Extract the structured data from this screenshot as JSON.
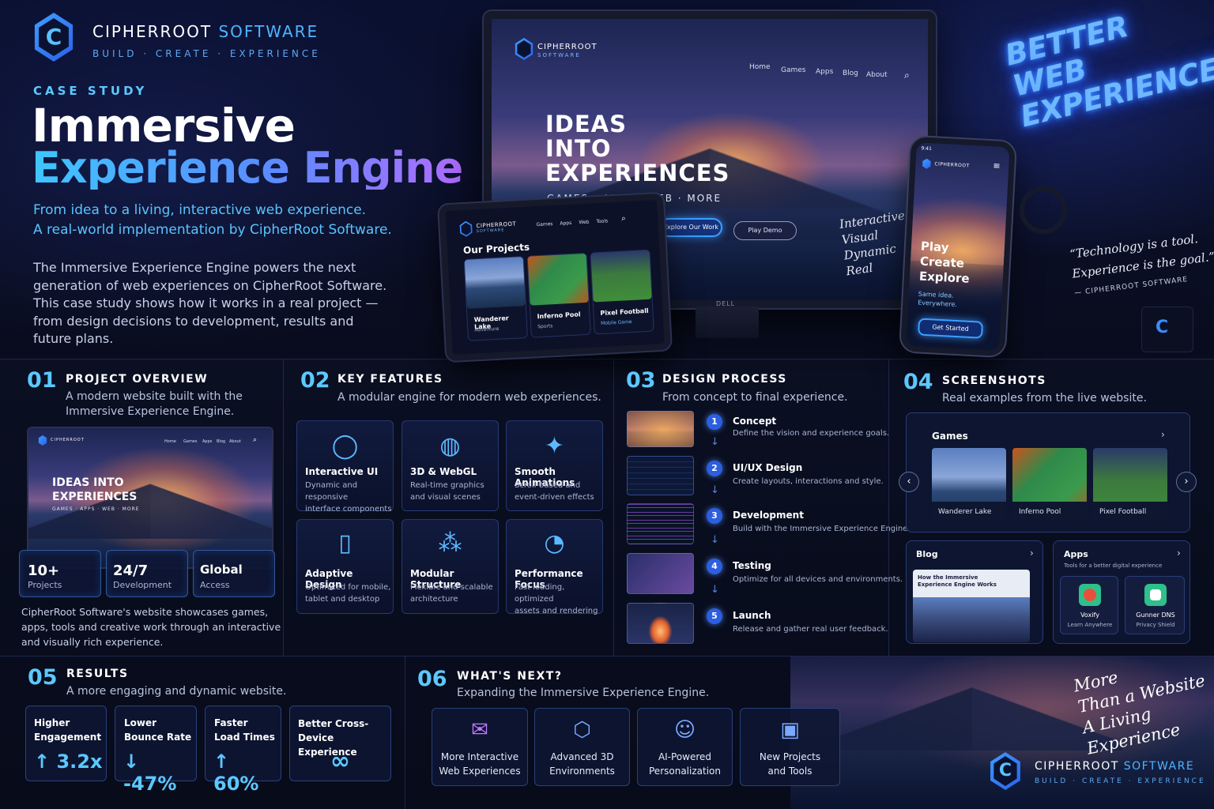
{
  "brand": {
    "name_a": "CIPHERROOT",
    "name_b": "SOFTWARE",
    "tagline": "BUILD · CREATE · EXPERIENCE",
    "logo_letter": "C"
  },
  "hero": {
    "kicker": "CASE STUDY",
    "title_line1": "Immersive",
    "title_line2": "Experience Engine",
    "lead_1": "From idea to a living, interactive web experience.",
    "lead_2": "A real-world implementation by CipherRoot Software.",
    "body": [
      "The Immersive Experience Engine powers the next",
      "generation of web experiences on CipherRoot Software.",
      "This case study shows how it works in a real project —",
      "from design decisions to development, results and",
      "future plans."
    ]
  },
  "monitor": {
    "logo_name": "CIPHERROOT",
    "logo_sub": "SOFTWARE",
    "nav": [
      "Home",
      "Games",
      "Apps",
      "Blog",
      "About"
    ],
    "headline": [
      "IDEAS",
      "INTO",
      "EXPERIENCES"
    ],
    "subline": "GAMES · APPS · WEB · MORE",
    "btn_primary": "Explore Our Work",
    "btn_secondary": "Play Demo",
    "script": [
      "Interactive",
      "Visual",
      "Dynamic",
      "Real"
    ],
    "stand_label": "DELL"
  },
  "tablet": {
    "logo_name": "CIPHERROOT",
    "logo_sub": "SOFTWARE",
    "nav": [
      "Games",
      "Apps",
      "Web",
      "Tools"
    ],
    "heading": "Our Projects",
    "projects": [
      {
        "name": "Wanderer Lake",
        "tag": "Adventure"
      },
      {
        "name": "Inferno Pool",
        "tag": "Sports"
      },
      {
        "name": "Pixel Football",
        "tag": "Mobile Game"
      }
    ]
  },
  "phone": {
    "time": "9:41",
    "logo_name": "CIPHERROOT",
    "headline": [
      "Play",
      "Create",
      "Explore"
    ],
    "tagline": [
      "Same idea.",
      "Everywhere."
    ],
    "cta": "Get Started"
  },
  "neon": [
    "BETTER",
    "WEB",
    "EXPERIENCES"
  ],
  "quote": {
    "line1": "“Technology is a tool.",
    "line2": "Experience is the goal.”",
    "attribution": "— CIPHERROOT SOFTWARE"
  },
  "overview": {
    "num": "01",
    "title": "PROJECT OVERVIEW",
    "sub": [
      "A modern website built with the",
      "Immersive Experience Engine."
    ],
    "screen_headline": [
      "IDEAS INTO",
      "EXPERIENCES"
    ],
    "screen_sub": "GAMES · APPS · WEB · MORE",
    "screen_nav": [
      "Home",
      "Games",
      "Apps",
      "Blog",
      "About"
    ],
    "stats": [
      {
        "big": "10+",
        "small": "Projects"
      },
      {
        "big": "24/7",
        "small": "Development"
      },
      {
        "big": "Global",
        "small": "Access"
      }
    ],
    "desc": [
      "CipherRoot Software's website showcases games,",
      "apps, tools and creative work through an interactive",
      "and visually rich experience."
    ]
  },
  "features": {
    "num": "02",
    "title": "KEY FEATURES",
    "sub": "A modular engine for modern web experiences.",
    "items": [
      {
        "icon": "cursor-icon",
        "glyph": "◯",
        "title": "Interactive UI",
        "desc": [
          "Dynamic and responsive",
          "interface components"
        ]
      },
      {
        "icon": "globe-icon",
        "glyph": "◍",
        "title": "3D & WebGL",
        "desc": [
          "Real-time graphics",
          "and visual scenes"
        ]
      },
      {
        "icon": "sparkle-wand-icon",
        "glyph": "✦",
        "title": "Smooth Animations",
        "desc": [
          "Scroll-based and",
          "event-driven effects"
        ]
      },
      {
        "icon": "mobile-icon",
        "glyph": "▯",
        "title": "Adaptive Design",
        "desc": [
          "Optimized for mobile,",
          "tablet and desktop"
        ]
      },
      {
        "icon": "modules-icon",
        "glyph": "⁂",
        "title": "Modular Structure",
        "desc": [
          "Flexible and scalable",
          "architecture"
        ]
      },
      {
        "icon": "speedometer-icon",
        "glyph": "◔",
        "title": "Performance Focus",
        "desc": [
          "Fast loading, optimized",
          "assets and rendering"
        ]
      }
    ]
  },
  "process": {
    "num": "03",
    "title": "DESIGN PROCESS",
    "sub": "From concept to final experience.",
    "steps": [
      {
        "n": "1",
        "title": "Concept",
        "desc": "Define the vision and experience goals."
      },
      {
        "n": "2",
        "title": "UI/UX Design",
        "desc": "Create layouts, interactions and style."
      },
      {
        "n": "3",
        "title": "Development",
        "desc": "Build with the Immersive Experience Engine."
      },
      {
        "n": "4",
        "title": "Testing",
        "desc": "Optimize for all devices and environments."
      },
      {
        "n": "5",
        "title": "Launch",
        "desc": "Release and gather real user feedback."
      }
    ]
  },
  "screenshots": {
    "num": "04",
    "title": "SCREENSHOTS",
    "sub": "Real examples from the live website.",
    "games_label": "Games",
    "games": [
      "Wanderer Lake",
      "Inferno Pool",
      "Pixel Football"
    ],
    "blog_label": "Blog",
    "blog_post": [
      "How the Immersive",
      "Experience Engine Works"
    ],
    "apps_label": "Apps",
    "apps_sub": "Tools for a better digital experience",
    "apps": [
      {
        "name": "Voxify",
        "desc": "Learn Anywhere",
        "color": "#e8503a"
      },
      {
        "name": "Gunner DNS",
        "desc": "Privacy Shield",
        "color": "#2fbf8a"
      }
    ]
  },
  "results": {
    "num": "05",
    "title": "RESULTS",
    "sub": "A more engaging and dynamic website.",
    "cards": [
      {
        "label": [
          "Higher",
          "Engagement"
        ],
        "value": "↑ 3.2x"
      },
      {
        "label": [
          "Lower",
          "Bounce Rate"
        ],
        "value": "↓ -47%"
      },
      {
        "label": [
          "Faster",
          "Load Times"
        ],
        "value": "↑ 60%"
      },
      {
        "label": [
          "Better Cross-Device",
          "Experience"
        ],
        "value": "∞"
      }
    ]
  },
  "next": {
    "num": "06",
    "title": "WHAT'S NEXT?",
    "sub": "Expanding the Immersive Experience Engine.",
    "items": [
      {
        "icon": "envelope-sparkle-icon",
        "glyph": "✉",
        "label": [
          "More Interactive",
          "Web Experiences"
        ]
      },
      {
        "icon": "cube-icon",
        "glyph": "⬡",
        "label": [
          "Advanced 3D",
          "Environments"
        ]
      },
      {
        "icon": "user-ai-icon",
        "glyph": "☺",
        "label": [
          "AI-Powered",
          "Personalization"
        ]
      },
      {
        "icon": "box-list-icon",
        "glyph": "▣",
        "label": [
          "New Projects",
          "and Tools"
        ]
      }
    ]
  },
  "closing": [
    "More",
    "Than a Website",
    "A Living Experience"
  ],
  "colors": {
    "accent": "#5cc8ff",
    "brand_blue": "#2a5ee8",
    "purple": "#b06cff"
  }
}
